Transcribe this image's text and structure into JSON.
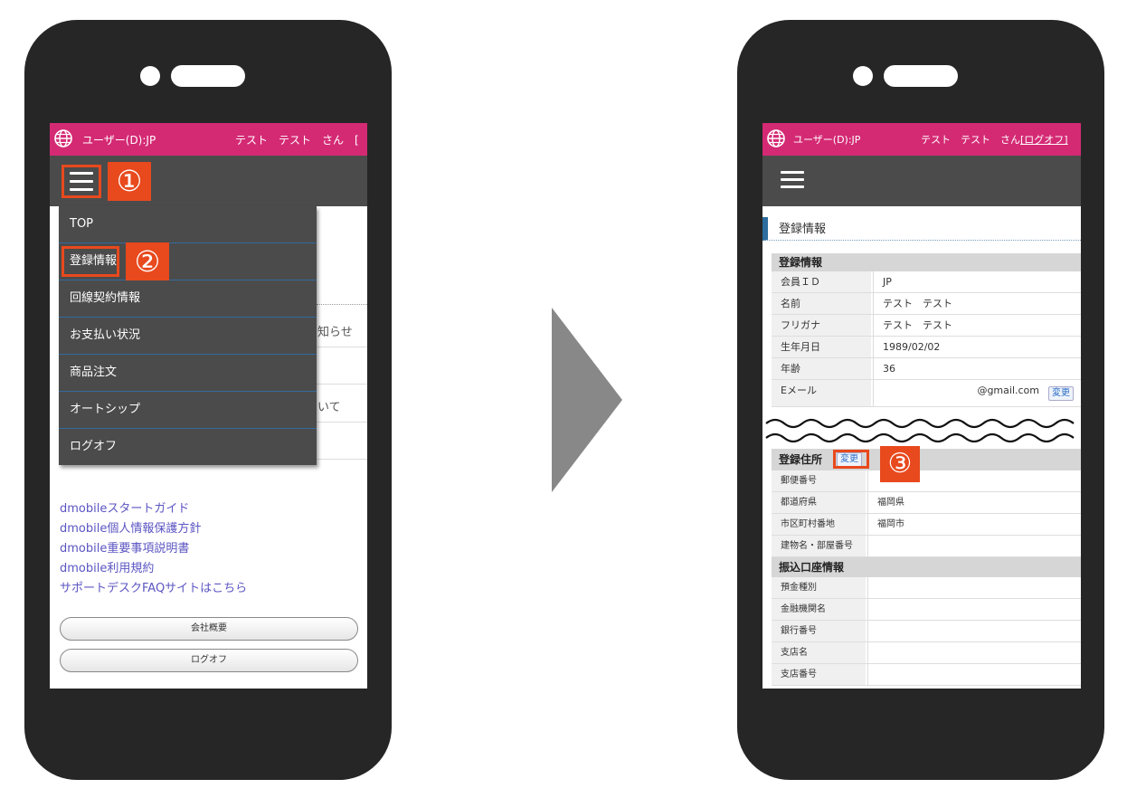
{
  "left_screen": {
    "topbar": {
      "user_id": "ユーザー(D):JP",
      "user_name": "テスト　テスト　さん　["
    },
    "step1": "①",
    "step2": "②",
    "menu": [
      "TOP",
      "登録情報",
      "回線契約情報",
      "お支払い状況",
      "商品注文",
      "オートシップ",
      "ログオフ"
    ],
    "bg_fragments": [
      "知らせ",
      "いて"
    ],
    "links": [
      "dmobileスタートガイド",
      "dmobile個人情報保護方針",
      "dmobile重要事項説明書",
      "dmobile利用規約",
      "サポートデスクFAQサイトはこちら"
    ],
    "buttons": [
      "会社概要",
      "ログオフ"
    ]
  },
  "right_screen": {
    "topbar": {
      "user_id": "ユーザー(D):JP",
      "user_name": "テスト　テスト　さん",
      "logoff": "[ログオフ]"
    },
    "section_title": "登録情報",
    "table1_title": "登録情報",
    "table1_rows": [
      {
        "label": "会員ＩＤ",
        "value": "JP"
      },
      {
        "label": "名前",
        "value": "テスト　テスト"
      },
      {
        "label": "フリガナ",
        "value": "テスト　テスト"
      },
      {
        "label": "生年月日",
        "value": "1989/02/02"
      },
      {
        "label": "年齢",
        "value": "36"
      },
      {
        "label": "Eメール",
        "value": "@gmail.com"
      }
    ],
    "email_change": "変更",
    "table2_title": "登録住所",
    "address_change": "変更",
    "step3": "③",
    "table2_rows": [
      {
        "label": "郵便番号",
        "value": ""
      },
      {
        "label": "都道府県",
        "value": "福岡県"
      },
      {
        "label": "市区町村番地",
        "value": "福岡市"
      },
      {
        "label": "建物名・部屋番号",
        "value": ""
      }
    ],
    "table3_title": "振込口座情報",
    "table3_rows": [
      {
        "label": "預金種別",
        "value": ""
      },
      {
        "label": "金融機関名",
        "value": ""
      },
      {
        "label": "銀行番号",
        "value": ""
      },
      {
        "label": "支店名",
        "value": ""
      },
      {
        "label": "支店番号",
        "value": ""
      }
    ]
  },
  "colors": {
    "topbar": "#d42a74",
    "navbar": "#4b4b4b",
    "highlight": "#e8491d",
    "phone": "#262626",
    "arrow": "#888888"
  },
  "icons": [
    "globe-icon",
    "hamburger-menu-icon",
    "next-step-arrow"
  ]
}
